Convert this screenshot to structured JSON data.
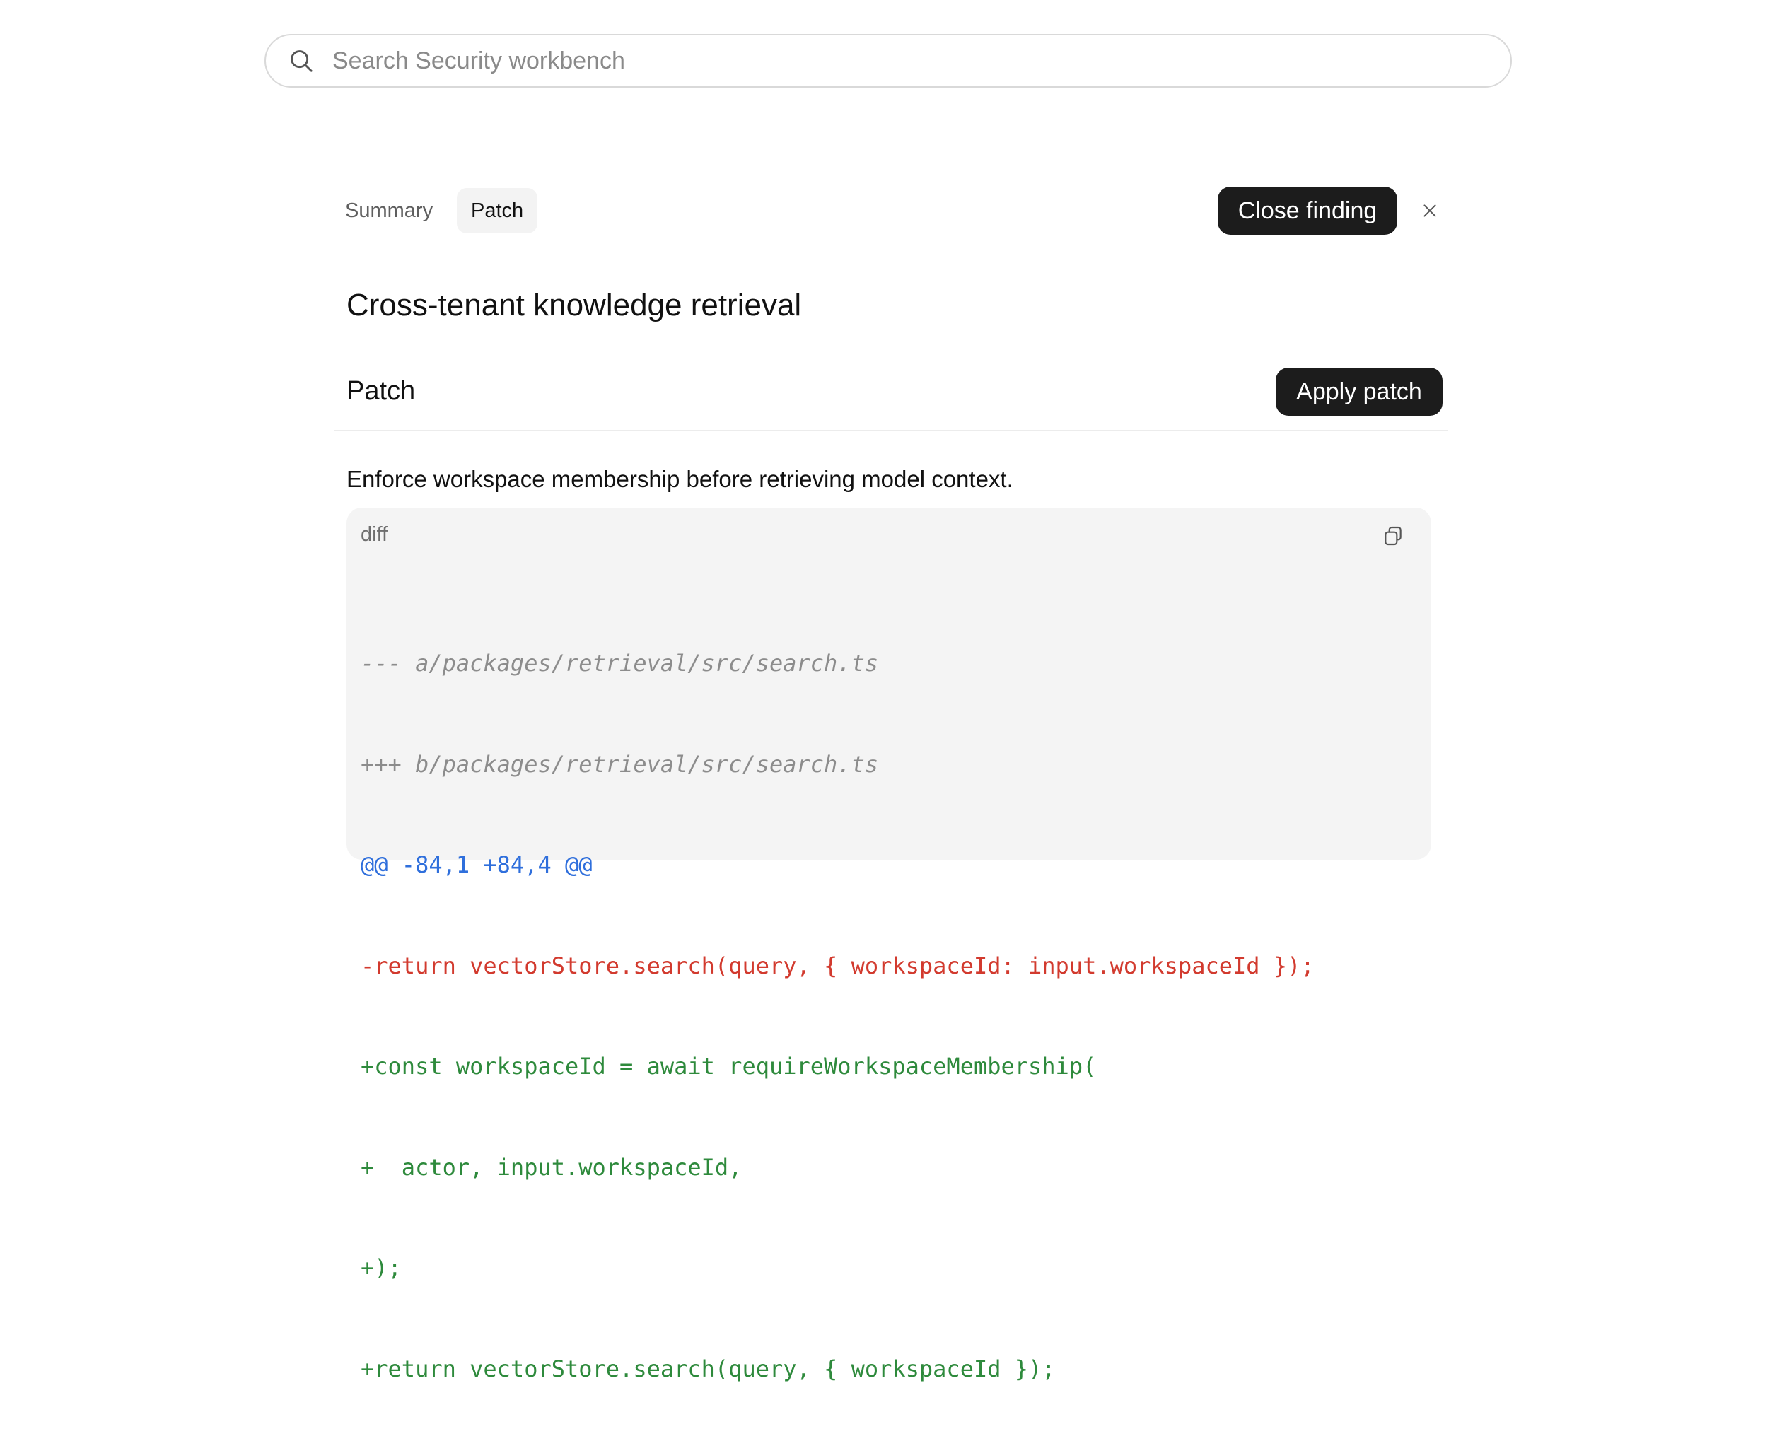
{
  "search": {
    "placeholder": "Search Security workbench"
  },
  "tabs": [
    {
      "label": "Summary",
      "active": false
    },
    {
      "label": "Patch",
      "active": true
    }
  ],
  "header": {
    "close_finding_label": "Close finding"
  },
  "finding": {
    "title": "Cross-tenant knowledge retrieval"
  },
  "patch": {
    "heading": "Patch",
    "apply_label": "Apply patch",
    "description": "Enforce workspace membership before retrieving model context.",
    "code": {
      "language": "diff",
      "lines": [
        {
          "type": "meta",
          "text": "--- a/packages/retrieval/src/search.ts"
        },
        {
          "type": "meta",
          "text": "+++ b/packages/retrieval/src/search.ts"
        },
        {
          "type": "hunk",
          "text": "@@ -84,1 +84,4 @@"
        },
        {
          "type": "del",
          "text": "-return vectorStore.search(query, { workspaceId: input.workspaceId });"
        },
        {
          "type": "add",
          "text": "+const workspaceId = await requireWorkspaceMembership("
        },
        {
          "type": "add",
          "text": "+  actor, input.workspaceId,"
        },
        {
          "type": "add",
          "text": "+);"
        },
        {
          "type": "add",
          "text": "+return vectorStore.search(query, { workspaceId });"
        }
      ]
    }
  },
  "icons": {
    "search": "search-icon",
    "close": "close-icon",
    "copy": "copy-icon"
  },
  "colors": {
    "button_bg": "#1c1c1c",
    "diff_deleted": "#d23a2e",
    "diff_added": "#2e8a3c",
    "diff_hunk": "#2f6fdc",
    "diff_meta": "#8c8c8c"
  }
}
